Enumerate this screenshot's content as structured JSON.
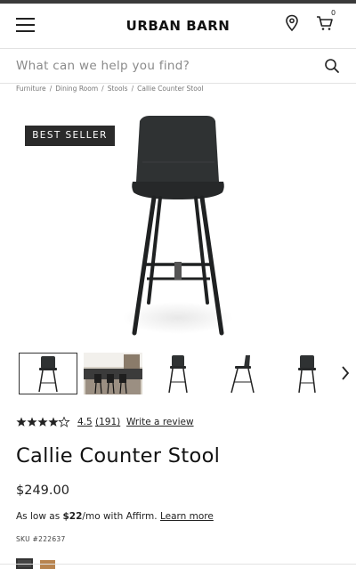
{
  "header": {
    "logo": "URBAN BARN",
    "cart_count": "0"
  },
  "search": {
    "placeholder": "What can we help you find?"
  },
  "breadcrumb": [
    "Furniture",
    "Dining Room",
    "Stools",
    "Callie Counter Stool"
  ],
  "badge": "BEST SELLER",
  "rating": {
    "stars": 4.5,
    "value": "4.5",
    "count": "(191)",
    "write_review": "Write a review"
  },
  "product": {
    "title": "Callie Counter Stool",
    "price": "$249.00",
    "affirm_prefix": "As low as ",
    "affirm_amount": "$22",
    "affirm_suffix": "/mo with Affirm.",
    "affirm_link": "Learn more",
    "sku": "SKU #222637"
  },
  "colors": {
    "accent": "#2b2b2b",
    "swatch_black": "#444444",
    "swatch_tan": "#b8844f"
  },
  "icons": [
    "hamburger-icon",
    "location-pin-icon",
    "cart-icon",
    "search-icon",
    "chevron-right-icon",
    "star-icon"
  ]
}
